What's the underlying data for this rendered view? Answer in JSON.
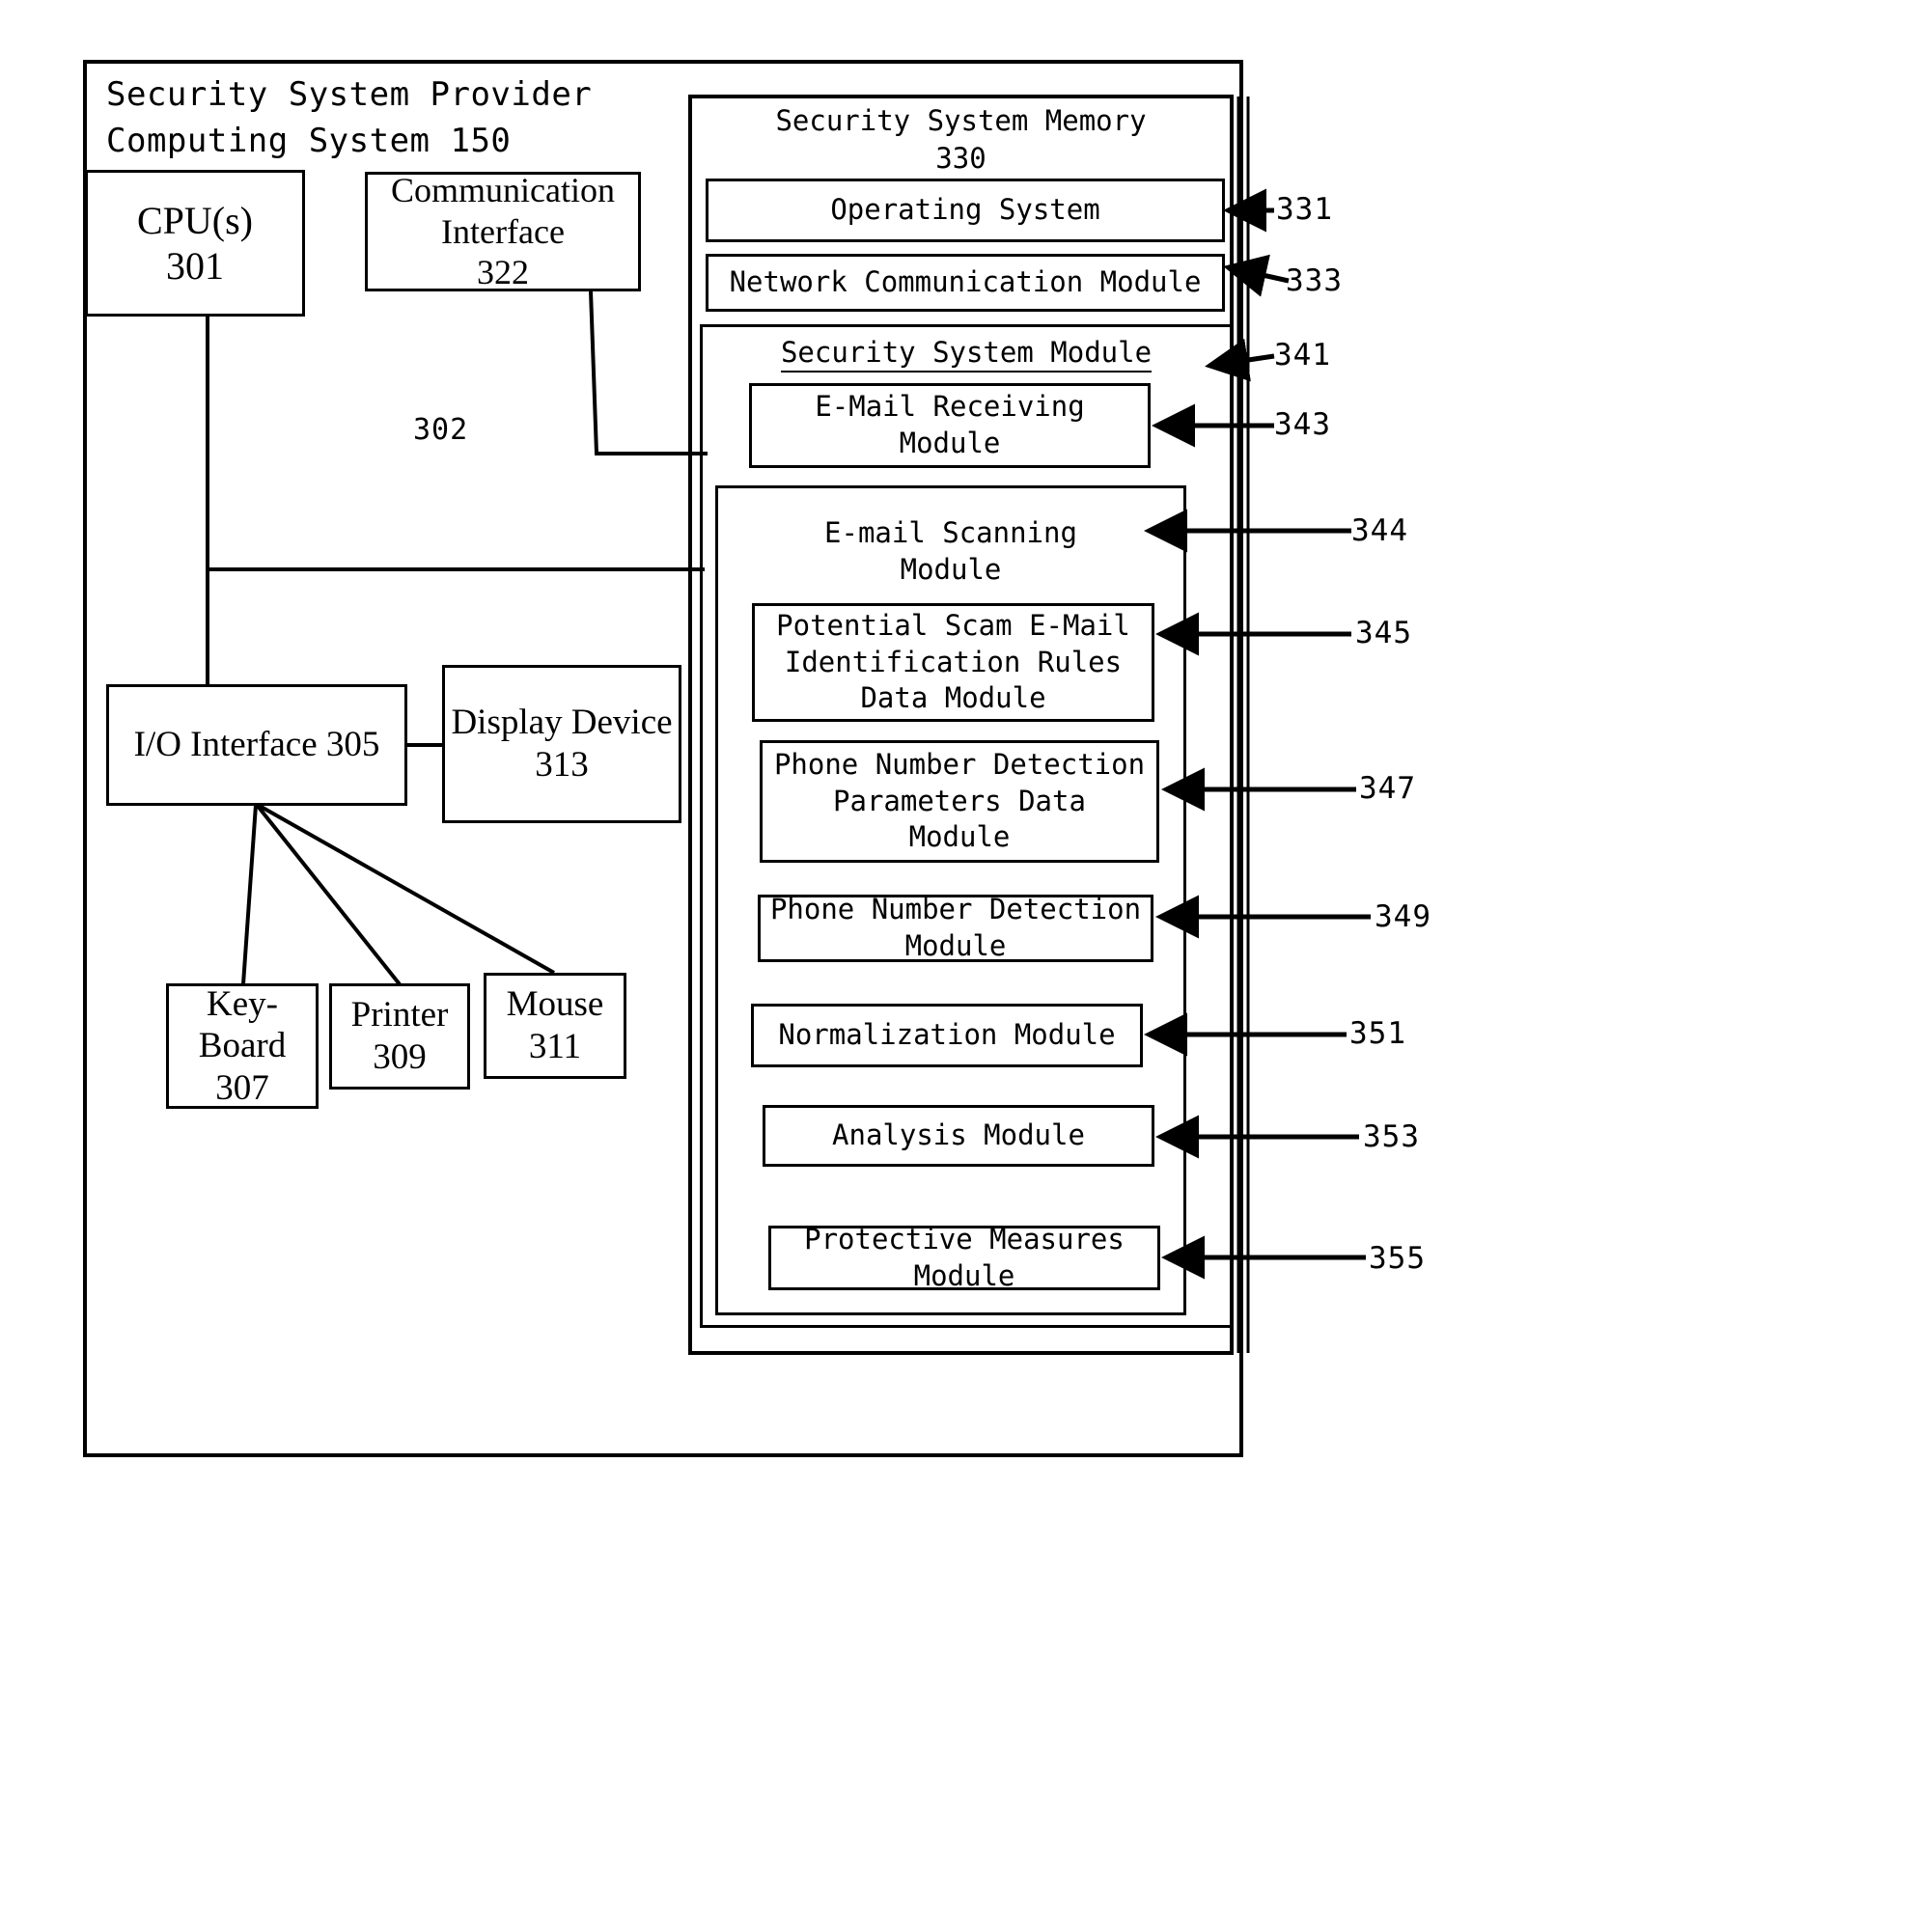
{
  "figure": {
    "outer_title": "Security System Provider\nComputing System 150",
    "bus_label": "302"
  },
  "left_column": {
    "cpu": {
      "label": "CPU(s)\n301"
    },
    "communication_interface": {
      "label": "Communication\nInterface\n322"
    },
    "io_interface": {
      "label": "I/O Interface 305"
    },
    "display_device": {
      "label": "Display Device\n313"
    },
    "keyboard": {
      "label": "Key-\nBoard\n307"
    },
    "printer": {
      "label": "Printer\n309"
    },
    "mouse": {
      "label": "Mouse\n311"
    }
  },
  "memory": {
    "title": "Security System Memory\n330",
    "operating_system": {
      "label": "Operating System",
      "ref": "331"
    },
    "network_communication_module": {
      "label": "Network Communication Module",
      "ref": "333"
    },
    "security_system_module": {
      "label": "Security System Module",
      "ref": "341",
      "email_receiving_module": {
        "label": "E-Mail Receiving\nModule",
        "ref": "343"
      },
      "email_scanning_module": {
        "label": "E-mail Scanning\nModule",
        "ref": "344",
        "potential_scam_rules_module": {
          "label": "Potential Scam E-Mail\nIdentification Rules\nData Module",
          "ref": "345"
        },
        "phone_number_detection_parameters_module": {
          "label": "Phone Number Detection\nParameters Data\nModule",
          "ref": "347"
        },
        "phone_number_detection_module": {
          "label": "Phone Number Detection\nModule",
          "ref": "349"
        },
        "normalization_module": {
          "label": "Normalization Module",
          "ref": "351"
        },
        "analysis_module": {
          "label": "Analysis Module",
          "ref": "353"
        },
        "protective_measures_module": {
          "label": "Protective Measures\nModule",
          "ref": "355"
        }
      }
    }
  },
  "colors": {
    "ink": "#000000",
    "paper": "#ffffff"
  }
}
